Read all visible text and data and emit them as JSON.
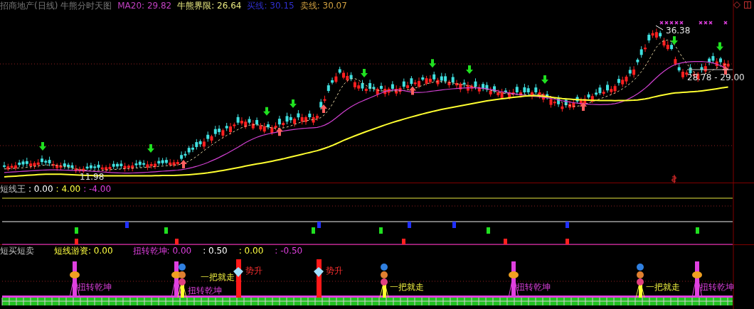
{
  "main_chart": {
    "title": "招商地产(日线) 牛熊分时天图",
    "legend": [
      {
        "text": "MA20: 29.82",
        "color": "#c040c0"
      },
      {
        "text": "牛熊界限: 26.64",
        "color": "#e8e880"
      },
      {
        "text": "买线: 30.15",
        "color": "#3030d0"
      },
      {
        "text": "卖线: 30.07",
        "color": "#d0a040"
      }
    ],
    "high_label": "36.38",
    "low_label": "11.98",
    "range_label": "28.78 - 29.00"
  },
  "pane_2": {
    "title": "短线王",
    "values": [
      {
        "text": ": 0.00",
        "color": "#ffffff"
      },
      {
        "text": ": 4.00",
        "color": "#ffff40"
      },
      {
        "text": ": -4.00",
        "color": "#e040e0"
      }
    ]
  },
  "pane_3": {
    "title": "短买短卖",
    "values": [
      {
        "text": "短线游资: 0.00",
        "color": "#ffff40"
      },
      {
        "text": "扭转乾坤: 0.00",
        "color": "#e040e0"
      },
      {
        "text": ": 0.50",
        "color": "#ffffff"
      },
      {
        "text": ": 0.00",
        "color": "#ffff40"
      },
      {
        "text": ": -0.50",
        "color": "#e040e0"
      }
    ],
    "signals": [
      {
        "kind": "reversal",
        "label": "扭转乾坤"
      },
      {
        "kind": "reversal",
        "label": "扭转乾坤"
      },
      {
        "kind": "exit",
        "label": "一把就走"
      },
      {
        "kind": "trend",
        "label": "势升"
      },
      {
        "kind": "trend",
        "label": "势升"
      },
      {
        "kind": "exit",
        "label": "一把就走"
      },
      {
        "kind": "reversal",
        "label": "扭转乾坤"
      },
      {
        "kind": "exit",
        "label": "一把就走"
      },
      {
        "kind": "reversal",
        "label": "扭转乾坤"
      }
    ]
  }
}
